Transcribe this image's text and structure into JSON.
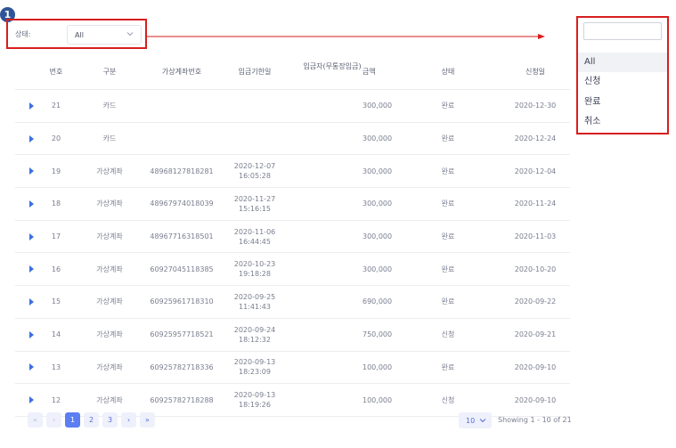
{
  "annotation": {
    "step_number": "1"
  },
  "filter": {
    "label": "상태:",
    "selected": "All"
  },
  "dropdown": {
    "search_value": "",
    "options": [
      "All",
      "신청",
      "완료",
      "취소"
    ],
    "selected_index": 0
  },
  "table": {
    "headers": {
      "no": "번호",
      "type": "구분",
      "account": "가상계좌번호",
      "due": "입금기한일",
      "payer": "입금자(무통장입금)",
      "amount": "금액",
      "status": "상태",
      "date": "신청일"
    },
    "rows": [
      {
        "no": "21",
        "type": "카드",
        "account": "",
        "due_date": "",
        "due_time": "",
        "payer": "",
        "amount": "300,000",
        "status": "완료",
        "date": "2020-12-30"
      },
      {
        "no": "20",
        "type": "카드",
        "account": "",
        "due_date": "",
        "due_time": "",
        "payer": "",
        "amount": "300,000",
        "status": "완료",
        "date": "2020-12-24"
      },
      {
        "no": "19",
        "type": "가상계좌",
        "account": "48968127818281",
        "due_date": "2020-12-07",
        "due_time": "16:05:28",
        "payer": "",
        "amount": "300,000",
        "status": "완료",
        "date": "2020-12-04"
      },
      {
        "no": "18",
        "type": "가상계좌",
        "account": "48967974018039",
        "due_date": "2020-11-27",
        "due_time": "15:16:15",
        "payer": "",
        "amount": "300,000",
        "status": "완료",
        "date": "2020-11-24"
      },
      {
        "no": "17",
        "type": "가상계좌",
        "account": "48967716318501",
        "due_date": "2020-11-06",
        "due_time": "16:44:45",
        "payer": "",
        "amount": "300,000",
        "status": "완료",
        "date": "2020-11-03"
      },
      {
        "no": "16",
        "type": "가상계좌",
        "account": "60927045118385",
        "due_date": "2020-10-23",
        "due_time": "19:18:28",
        "payer": "",
        "amount": "300,000",
        "status": "완료",
        "date": "2020-10-20"
      },
      {
        "no": "15",
        "type": "가상계좌",
        "account": "60925961718310",
        "due_date": "2020-09-25",
        "due_time": "11:41:43",
        "payer": "",
        "amount": "690,000",
        "status": "완료",
        "date": "2020-09-22"
      },
      {
        "no": "14",
        "type": "가상계좌",
        "account": "60925957718521",
        "due_date": "2020-09-24",
        "due_time": "18:12:32",
        "payer": "",
        "amount": "750,000",
        "status": "신청",
        "date": "2020-09-21"
      },
      {
        "no": "13",
        "type": "가상계좌",
        "account": "60925782718336",
        "due_date": "2020-09-13",
        "due_time": "18:23:09",
        "payer": "",
        "amount": "100,000",
        "status": "완료",
        "date": "2020-09-10"
      },
      {
        "no": "12",
        "type": "가상계좌",
        "account": "60925782718288",
        "due_date": "2020-09-13",
        "due_time": "18:19:26",
        "payer": "",
        "amount": "100,000",
        "status": "신청",
        "date": "2020-09-10"
      }
    ]
  },
  "pagination": {
    "first": "«",
    "prev": "‹",
    "pages": [
      "1",
      "2",
      "3"
    ],
    "active_page": "1",
    "next": "›",
    "last": "»",
    "page_size": "10",
    "showing_text": "Showing 1 - 10 of 21"
  },
  "colors": {
    "annotation_red": "#d81e1e",
    "accent": "#5b7ef2",
    "expand_icon": "#3d6ee6"
  }
}
